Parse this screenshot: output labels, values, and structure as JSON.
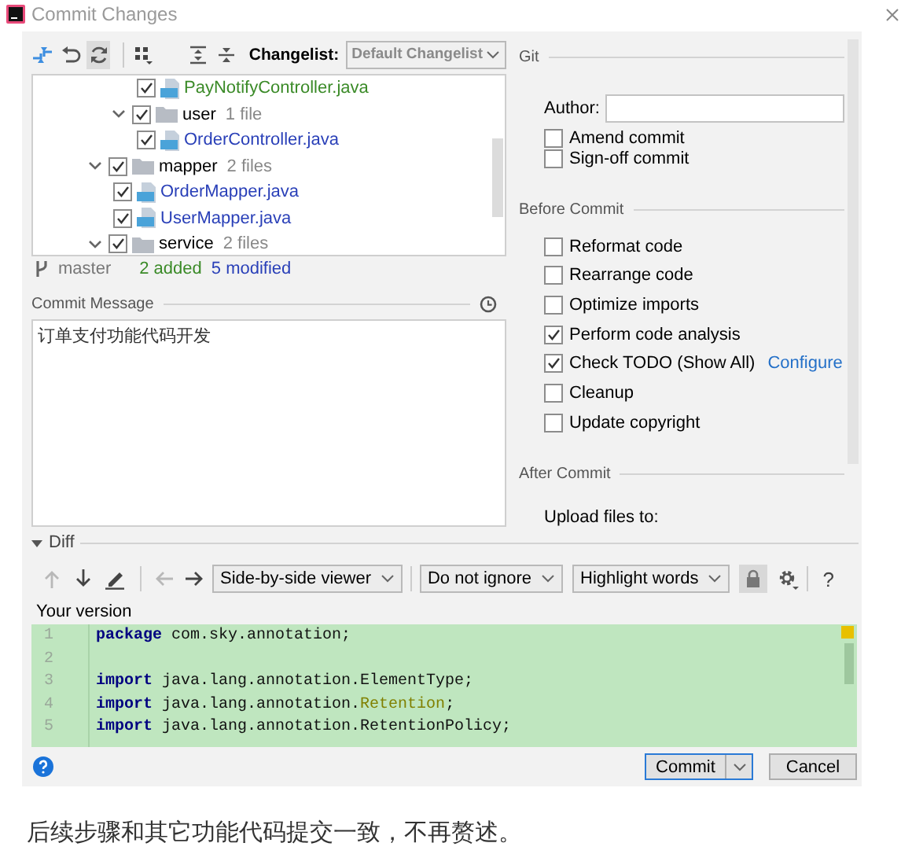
{
  "window": {
    "title": "Commit Changes"
  },
  "toolbar": {
    "changelist_label": "Changelist:",
    "changelist": "Default Changelist"
  },
  "tree": [
    {
      "children": [
        {
          "children": [
            {
              "kind": "file",
              "name": "PayNotifyController.java",
              "color": "#3a8a27",
              "checked": true
            }
          ]
        },
        {
          "kind": "folder",
          "name": "user",
          "count": "1 file",
          "expanded": true,
          "checked": true,
          "children": [
            {
              "kind": "file",
              "name": "OrderController.java",
              "color": "#2a40b8",
              "checked": true
            }
          ]
        }
      ]
    },
    {
      "kind": "folder",
      "name": "mapper",
      "count": "2 files",
      "expanded": true,
      "checked": true,
      "children": [
        {
          "kind": "file",
          "name": "OrderMapper.java",
          "color": "#2a40b8",
          "checked": true
        },
        {
          "kind": "file",
          "name": "UserMapper.java",
          "color": "#2a40b8",
          "checked": true
        }
      ]
    },
    {
      "kind": "folder",
      "name": "service",
      "count": "2 files",
      "expanded": true,
      "checked": true
    }
  ],
  "status": {
    "branch": "master",
    "added": "2 added",
    "modified": "5 modified"
  },
  "commit_message": {
    "label": "Commit Message",
    "value": "订单支付功能代码开发"
  },
  "git": {
    "title": "Git",
    "author_label": "Author:",
    "options": [
      {
        "label": "Amend commit",
        "checked": false
      },
      {
        "label": "Sign-off commit",
        "checked": false
      }
    ]
  },
  "before_commit": {
    "title": "Before Commit",
    "options": [
      {
        "label": "Reformat code",
        "checked": false
      },
      {
        "label": "Rearrange code",
        "checked": false
      },
      {
        "label": "Optimize imports",
        "checked": false
      },
      {
        "label": "Perform code analysis",
        "checked": true
      },
      {
        "label": "Check TODO (Show All)",
        "checked": true,
        "link": "Configure"
      },
      {
        "label": "Cleanup",
        "checked": false
      },
      {
        "label": "Update copyright",
        "checked": false
      }
    ]
  },
  "after_commit": {
    "title": "After Commit",
    "upload_label": "Upload files to:"
  },
  "diff": {
    "title": "Diff",
    "expanded": true,
    "nav": [
      {
        "kind": "up",
        "disabled": true
      },
      {
        "kind": "down",
        "disabled": false
      },
      {
        "kind": "edit",
        "disabled": false
      },
      {
        "kind": "left",
        "disabled": true
      },
      {
        "kind": "right",
        "disabled": false
      }
    ],
    "viewer": "Side-by-side viewer",
    "ignore": "Do not ignore",
    "highlight": "Highlight words",
    "locked": true,
    "help": "?",
    "version_label": "Your version",
    "lines": [
      {
        "number": "1",
        "tokens": [
          {
            "kind": "keyword",
            "text": "package"
          },
          {
            "kind": "plain",
            "text": " com.sky.annotation;"
          }
        ]
      },
      {
        "number": "2"
      },
      {
        "number": "3",
        "tokens": [
          {
            "kind": "keyword",
            "text": "import"
          },
          {
            "kind": "plain",
            "text": " java.lang.annotation.ElementType;"
          }
        ]
      },
      {
        "number": "4",
        "tokens": [
          {
            "kind": "keyword",
            "text": "import"
          },
          {
            "kind": "plain",
            "text": " java.lang.annotation."
          },
          {
            "kind": "class",
            "text": "Retention"
          },
          {
            "kind": "plain",
            "text": ";"
          }
        ]
      },
      {
        "number": "5",
        "tokens": [
          {
            "kind": "keyword",
            "text": "import"
          },
          {
            "kind": "plain",
            "text": " java.lang.annotation.RetentionPolicy;"
          }
        ]
      }
    ]
  },
  "buttons": [
    {
      "label": "Commit",
      "kind": "split",
      "default": true
    },
    {
      "label": "Cancel",
      "kind": "plain",
      "default": false
    }
  ],
  "caption": "后续步骤和其它功能代码提交一致，不再赘述。"
}
